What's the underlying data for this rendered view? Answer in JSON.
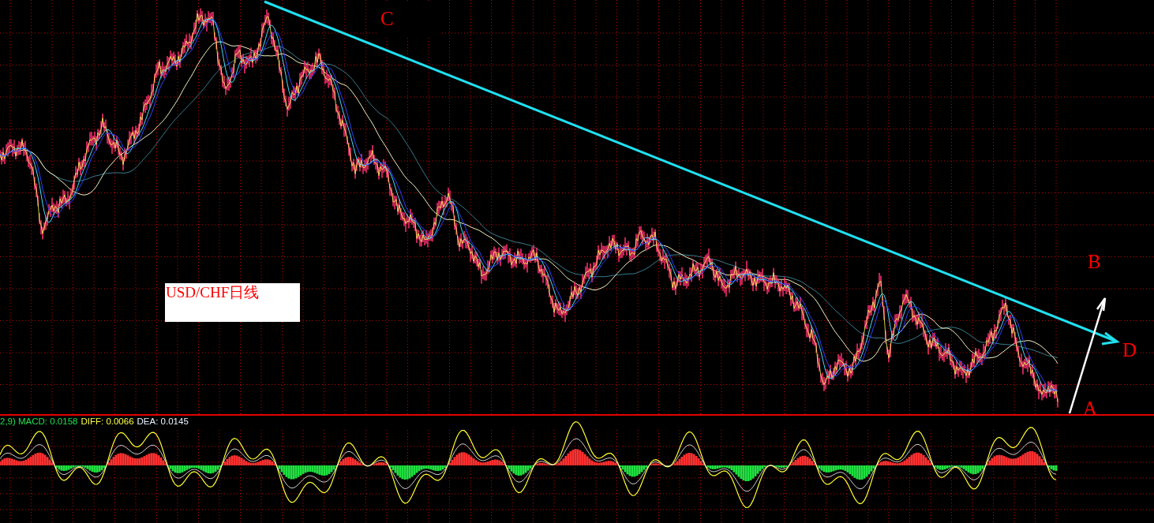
{
  "chart_title": "USD/CHF日线",
  "point_labels": [
    {
      "text": "C",
      "kind": "boxed"
    },
    {
      "text": "B",
      "kind": "plain"
    },
    {
      "text": "D",
      "kind": "plain"
    },
    {
      "text": "A",
      "kind": "plain"
    }
  ],
  "macd_legend": [
    {
      "text": "2,9) MACD: 0.0158",
      "color": "#20e050"
    },
    {
      "text": "DIFF: 0.0066",
      "color": "#ffff40"
    },
    {
      "text": "DEA: 0.0145",
      "color": "#e8f4ff"
    }
  ]
}
